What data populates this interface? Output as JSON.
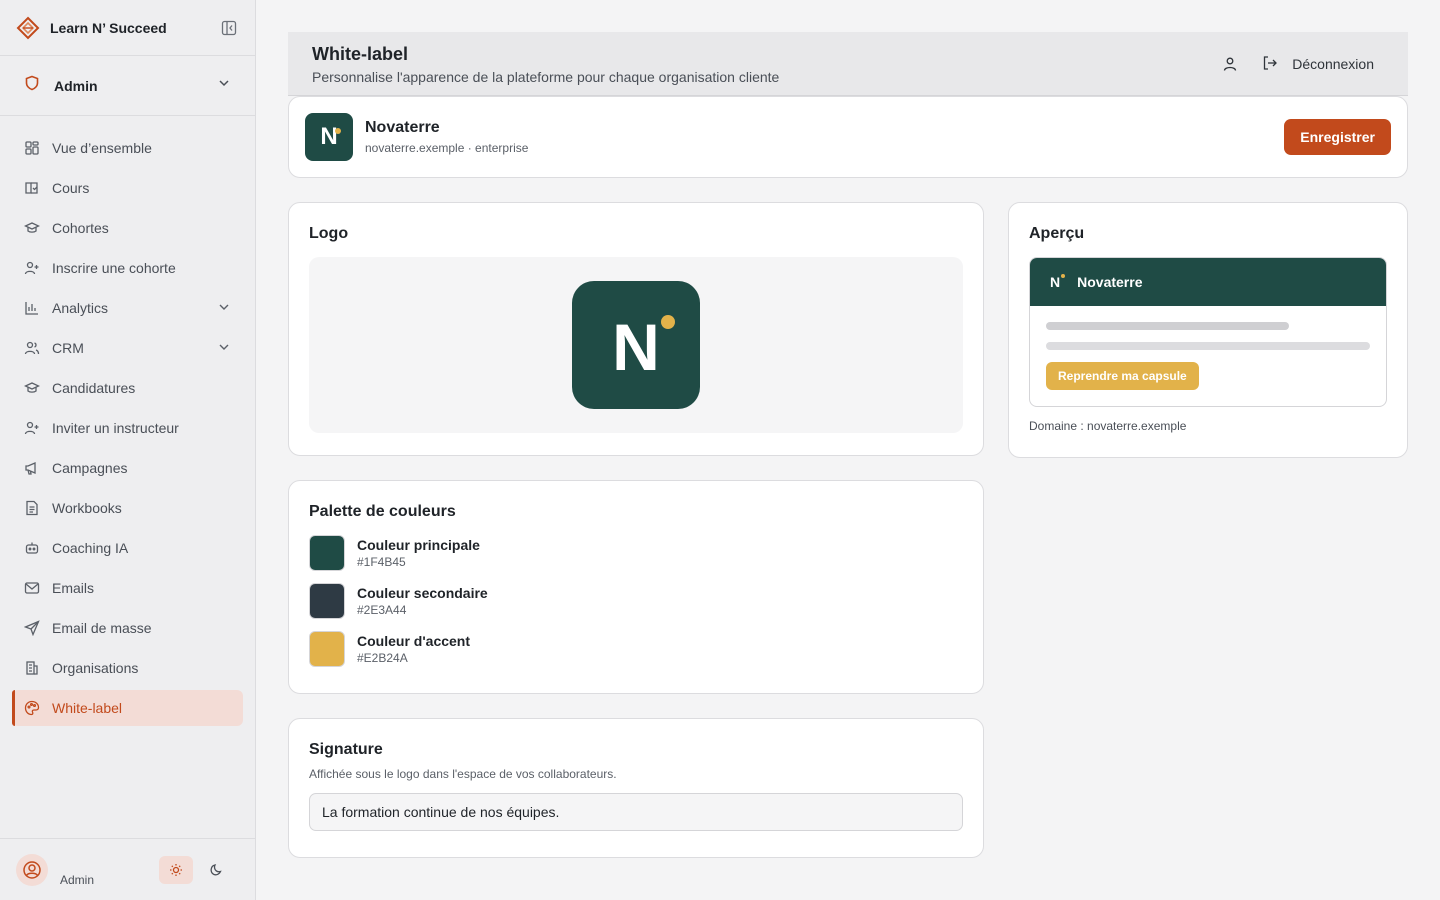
{
  "app": {
    "name": "Learn N’ Succeed"
  },
  "role": {
    "label": "Admin"
  },
  "sidebar": {
    "items": [
      {
        "label": "Vue d’ensemble",
        "icon": "dashboard-icon"
      },
      {
        "label": "Cours",
        "icon": "book-check-icon"
      },
      {
        "label": "Cohortes",
        "icon": "graduation-cap-icon"
      },
      {
        "label": "Inscrire une cohorte",
        "icon": "user-plus-icon"
      },
      {
        "label": "Analytics",
        "icon": "bar-chart-icon"
      },
      {
        "label": "CRM",
        "icon": "users-icon"
      },
      {
        "label": "Candidatures",
        "icon": "graduation-cap-icon"
      },
      {
        "label": "Inviter un instructeur",
        "icon": "user-plus-icon"
      },
      {
        "label": "Campagnes",
        "icon": "megaphone-icon"
      },
      {
        "label": "Workbooks",
        "icon": "file-text-icon"
      },
      {
        "label": "Coaching IA",
        "icon": "bot-icon"
      },
      {
        "label": "Emails",
        "icon": "mail-icon"
      },
      {
        "label": "Email de masse",
        "icon": "send-icon"
      },
      {
        "label": "Organisations",
        "icon": "building-icon"
      },
      {
        "label": "White-label",
        "icon": "palette-icon"
      }
    ],
    "active": "White-label",
    "footer_name": "Admin"
  },
  "header": {
    "title": "White-label",
    "subtitle": "Personnalise l'apparence de la plateforme pour chaque organisation cliente",
    "logout_label": "Déconnexion"
  },
  "org": {
    "logo_letter": "N",
    "name": "Novaterre",
    "meta": "novaterre.exemple · enterprise",
    "save_label": "Enregistrer"
  },
  "logo_section": {
    "title": "Logo",
    "letter": "N"
  },
  "palette": {
    "title": "Palette de couleurs",
    "colors": [
      {
        "name": "Couleur principale",
        "hex": "#1F4B45"
      },
      {
        "name": "Couleur secondaire",
        "hex": "#2E3A44"
      },
      {
        "name": "Couleur d'accent",
        "hex": "#E2B24A"
      }
    ]
  },
  "signature": {
    "title": "Signature",
    "description": "Affichée sous le logo dans l'espace de vos collaborateurs.",
    "value": "La formation continue de nos équipes."
  },
  "preview": {
    "title": "Aperçu",
    "letter": "N",
    "org_name": "Novaterre",
    "cta_label": "Reprendre ma capsule",
    "domain": "Domaine : novaterre.exemple"
  },
  "colors": {
    "accent": "#C24A1C",
    "primary": "#1F4B45",
    "secondary": "#2E3A44",
    "highlight": "#E2B24A"
  }
}
